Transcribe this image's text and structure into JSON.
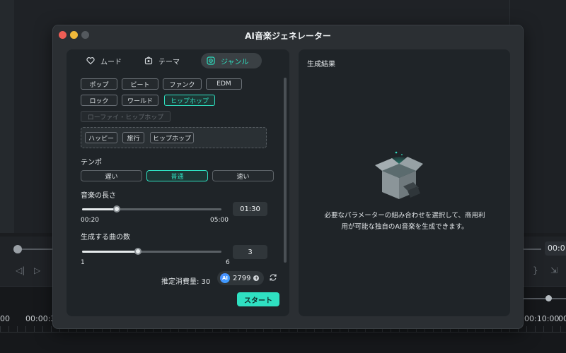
{
  "window": {
    "title": "AI音楽ジェネレーター"
  },
  "tabs": [
    {
      "label": "ムード",
      "icon": "mood-icon",
      "active": false
    },
    {
      "label": "テーマ",
      "icon": "theme-icon",
      "active": false
    },
    {
      "label": "ジャンル",
      "icon": "genre-icon",
      "active": true
    }
  ],
  "genres": [
    "ポップ",
    "ビート",
    "ファンク",
    "EDM",
    "ロック",
    "ワールド",
    "ヒップホップ",
    "ローファイ・ヒップホップ"
  ],
  "selected_genre": "ヒップホップ",
  "tags": [
    "ハッピー",
    "旅行",
    "ヒップホップ"
  ],
  "tempo": {
    "label": "テンポ",
    "options": [
      "遅い",
      "普通",
      "速い"
    ],
    "selected": "普通"
  },
  "length": {
    "label": "音楽の長さ",
    "min": "00:20",
    "max": "05:00",
    "value": "01:30",
    "fraction": 0.25
  },
  "count": {
    "label": "生成する曲の数",
    "min": "1",
    "max": "6",
    "value": "3",
    "fraction": 0.4
  },
  "cost": {
    "label": "推定消費量: 30",
    "credits": "2799"
  },
  "start_label": "スタート",
  "result": {
    "title": "生成結果",
    "empty_line1": "必要なパラメーターの組み合わせを選択して、商用利",
    "empty_line2": "用が可能な独自のAI音楽を生成できます。"
  },
  "background": {
    "time_right": "00:0",
    "timeline_labels": [
      "00",
      "00:00:3",
      "00:10:00",
      "00"
    ]
  },
  "colors": {
    "accent": "#2fe0c1",
    "panel": "#1f2428",
    "window": "#2b2f33"
  }
}
